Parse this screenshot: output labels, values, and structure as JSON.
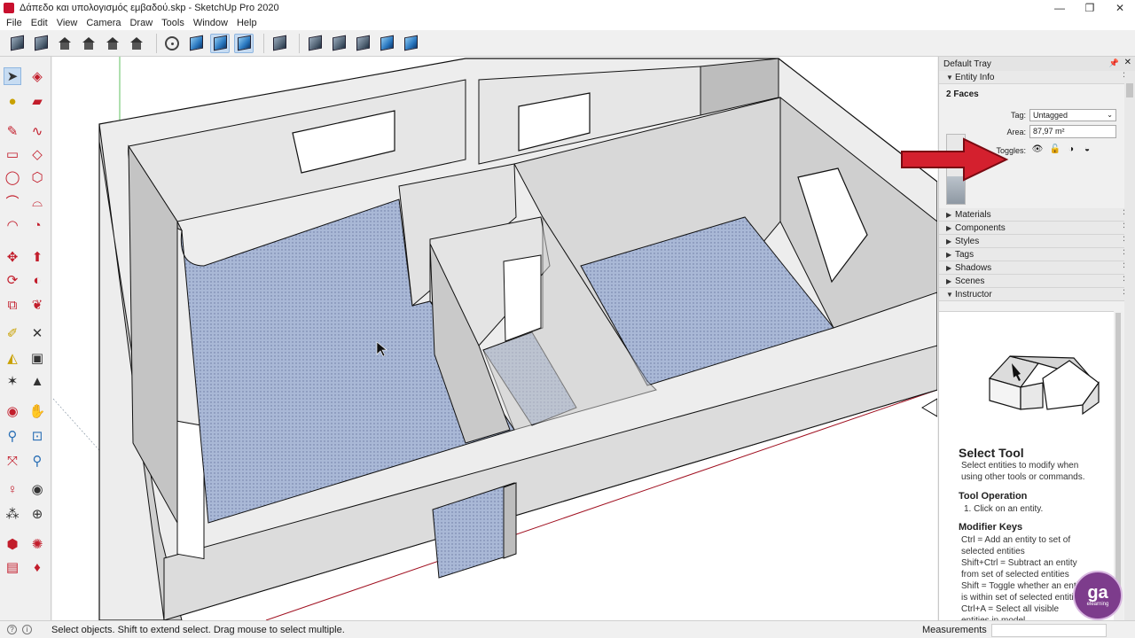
{
  "window": {
    "title": "Δάπεδο και υπολογισμός εμβαδού.skp - SketchUp Pro 2020",
    "controls": [
      "—",
      "❐",
      "✕"
    ]
  },
  "menu": [
    "File",
    "Edit",
    "View",
    "Camera",
    "Draw",
    "Tools",
    "Window",
    "Help"
  ],
  "tray": {
    "title": "Default Tray",
    "entity_info": {
      "header": "Entity Info",
      "selection": "2 Faces",
      "tag_label": "Tag:",
      "tag_value": "Untagged",
      "area_label": "Area:",
      "area_value": "87,97 m²",
      "toggles_label": "Toggles:"
    },
    "panels": [
      "Materials",
      "Components",
      "Styles",
      "Tags",
      "Shadows",
      "Scenes",
      "Instructor"
    ],
    "instructor": {
      "title": "Select Tool",
      "description_lines": [
        "Select entities to modify when",
        "using other tools or commands."
      ],
      "operation_title": "Tool Operation",
      "operation_lines": [
        "1. Click on an entity."
      ],
      "modifier_title": "Modifier Keys",
      "modifier_lines": [
        "Ctrl = Add an entity to set of",
        "selected entities",
        "Shift+Ctrl = Subtract an entity",
        "from set of selected entities",
        "Shift = Toggle whether an entity",
        "is within set of selected entities",
        "Ctrl+A = Select all visible",
        "entities in model"
      ]
    }
  },
  "status": {
    "message": "Select objects. Shift to extend select. Drag mouse to select multiple.",
    "measurements_label": "Measurements"
  },
  "logo": {
    "mark": "ga",
    "text": "elearning"
  },
  "colors": {
    "accent_red": "#d4202e",
    "floor_blue": "#a9b8d6",
    "wall_gray": "#d9d9d9",
    "logo_purple": "#7d3c8c"
  }
}
